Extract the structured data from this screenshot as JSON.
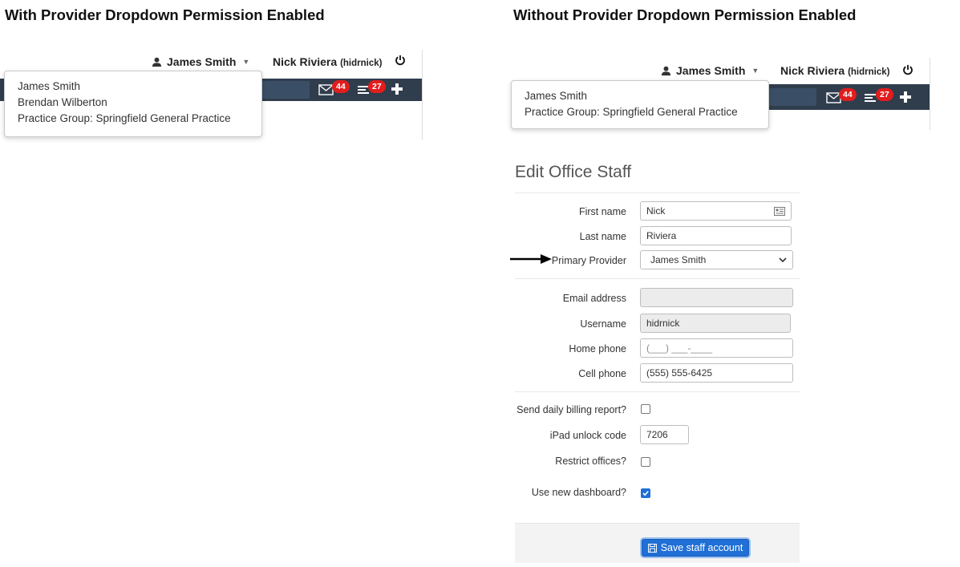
{
  "headings": {
    "left": "With Provider Dropdown Permission Enabled",
    "right": "Without Provider Dropdown Permission Enabled"
  },
  "topbar": {
    "provider_user": "James Smith",
    "staff_name": "Nick Riviera",
    "staff_username": "(hidrnick)",
    "messages_count": "44",
    "tasks_count": "27"
  },
  "dropdown_enabled": {
    "items": [
      "James Smith",
      "Brendan Wilberton",
      "Practice Group: Springfield General Practice"
    ]
  },
  "dropdown_disabled": {
    "items": [
      "James Smith",
      "Practice Group: Springfield General Practice"
    ]
  },
  "form": {
    "title": "Edit Office Staff",
    "first_name": {
      "label": "First name",
      "value": "Nick"
    },
    "last_name": {
      "label": "Last name",
      "value": "Riviera"
    },
    "primary_provider": {
      "label": "Primary Provider",
      "value": "James Smith"
    },
    "email": {
      "label": "Email address",
      "value": ""
    },
    "username": {
      "label": "Username",
      "value": "hidrnick"
    },
    "home_phone": {
      "label": "Home phone",
      "value": "(___) ___-____"
    },
    "cell_phone": {
      "label": "Cell phone",
      "value": "(555) 555-6425"
    },
    "billing_report": {
      "label": "Send daily billing report?",
      "checked": false
    },
    "ipad_code": {
      "label": "iPad unlock code",
      "value": "7206"
    },
    "restrict_offices": {
      "label": "Restrict offices?",
      "checked": false
    },
    "new_dashboard": {
      "label": "Use new dashboard?",
      "checked": true
    },
    "save_label": "Save staff account"
  },
  "colors": {
    "navbar": "#2f3d4d",
    "badge": "#e11d1d",
    "primary": "#1f6fd6"
  },
  "icons": {
    "user": "user-icon",
    "power": "power-icon",
    "envelope": "envelope-icon",
    "tasks": "tasks-icon",
    "plus": "plus-icon",
    "contact_card": "contact-card-icon",
    "chevron": "chevron-down-icon",
    "save": "floppy-disk-icon",
    "arrow": "arrow-right-icon"
  }
}
